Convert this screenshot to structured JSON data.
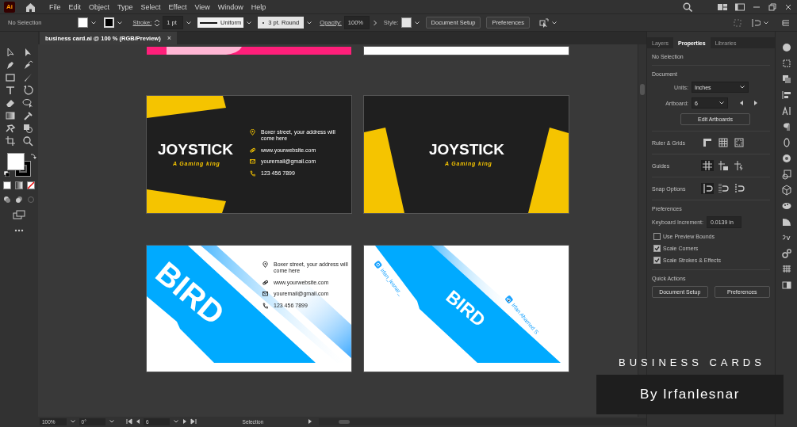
{
  "app_icon": "Ai",
  "menu": [
    "File",
    "Edit",
    "Object",
    "Type",
    "Select",
    "Effect",
    "View",
    "Window",
    "Help"
  ],
  "control_bar": {
    "selection": "No Selection",
    "stroke_label": "Stroke:",
    "stroke_weight": "1 pt",
    "stroke_profile": "Uniform",
    "brush": "3 pt. Round",
    "opacity_label": "Opacity:",
    "opacity": "100%",
    "style_label": "Style:",
    "buttons": [
      "Document Setup",
      "Preferences"
    ]
  },
  "document_tab": {
    "title": "business card.ai @ 100 % (RGB/Preview)",
    "close": "×"
  },
  "artboards": [
    {
      "kind": "cut_pink"
    },
    {
      "kind": "cut_white"
    },
    {
      "kind": "joystick_front",
      "logo": "JOYSTICK",
      "tagline": "A Gaming king",
      "contacts": [
        {
          "kind": "address",
          "text": "Boxer street, your address will come here"
        },
        {
          "kind": "web",
          "text": "www.yourwebsite.com"
        },
        {
          "kind": "email",
          "text": "youremail@gmail.com"
        },
        {
          "kind": "phone",
          "text": "123 456 7899"
        }
      ]
    },
    {
      "kind": "joystick_back",
      "logo": "JOYSTICK",
      "tagline": "A Gaming king"
    },
    {
      "kind": "bird_front",
      "logo": "BIRD",
      "contacts": [
        {
          "kind": "address",
          "text": "Boxer street, your address will come here"
        },
        {
          "kind": "web",
          "text": "www.yourwebsite.com"
        },
        {
          "kind": "email",
          "text": "youremail@gmail.com"
        },
        {
          "kind": "phone",
          "text": "123 456 7899"
        }
      ]
    },
    {
      "kind": "bird_back",
      "logo": "BIRD",
      "social": [
        {
          "kind": "instagram",
          "text": "irfan_lesnar_"
        },
        {
          "kind": "linkedin",
          "text": "Irfan Ahamed S"
        }
      ]
    }
  ],
  "panel": {
    "tabs": [
      {
        "label": "Layers",
        "selected": false
      },
      {
        "label": "Properties",
        "selected": true
      },
      {
        "label": "Libraries",
        "selected": false
      }
    ],
    "selection": "No Selection",
    "document": {
      "heading": "Document",
      "units_label": "Units:",
      "units": "Inches",
      "artboard_label": "Artboard:",
      "artboard": "6",
      "edit_button": "Edit Artboards"
    },
    "sections": [
      {
        "kind": "rulers",
        "label": "Ruler & Grids",
        "toggles": [
          {
            "on": false
          },
          {
            "on": false
          },
          {
            "on": false
          }
        ]
      },
      {
        "kind": "guides",
        "label": "Guides",
        "toggles": [
          {
            "on": true
          },
          {
            "on": false
          },
          {
            "on": false
          }
        ]
      },
      {
        "kind": "snap",
        "label": "Snap Options",
        "toggles": [
          {
            "on": true
          },
          {
            "on": false
          },
          {
            "on": false
          }
        ]
      }
    ],
    "preferences": {
      "heading": "Preferences",
      "increment_label": "Keyboard Increment:",
      "increment": "0.0139 in",
      "checkboxes": [
        {
          "label": "Use Preview Bounds",
          "checked": false
        },
        {
          "label": "Scale Corners",
          "checked": true
        },
        {
          "label": "Scale Strokes & Effects",
          "checked": true
        }
      ]
    },
    "quick_actions": {
      "heading": "Quick Actions",
      "buttons": [
        "Document Setup",
        "Preferences"
      ]
    }
  },
  "status_bar": {
    "zoom": "100%",
    "rotation": "0°",
    "artboard": "6",
    "tool": "Selection"
  },
  "caption": {
    "title": "BUSINESS CARDS",
    "byline": "By Irfanlesnar"
  }
}
